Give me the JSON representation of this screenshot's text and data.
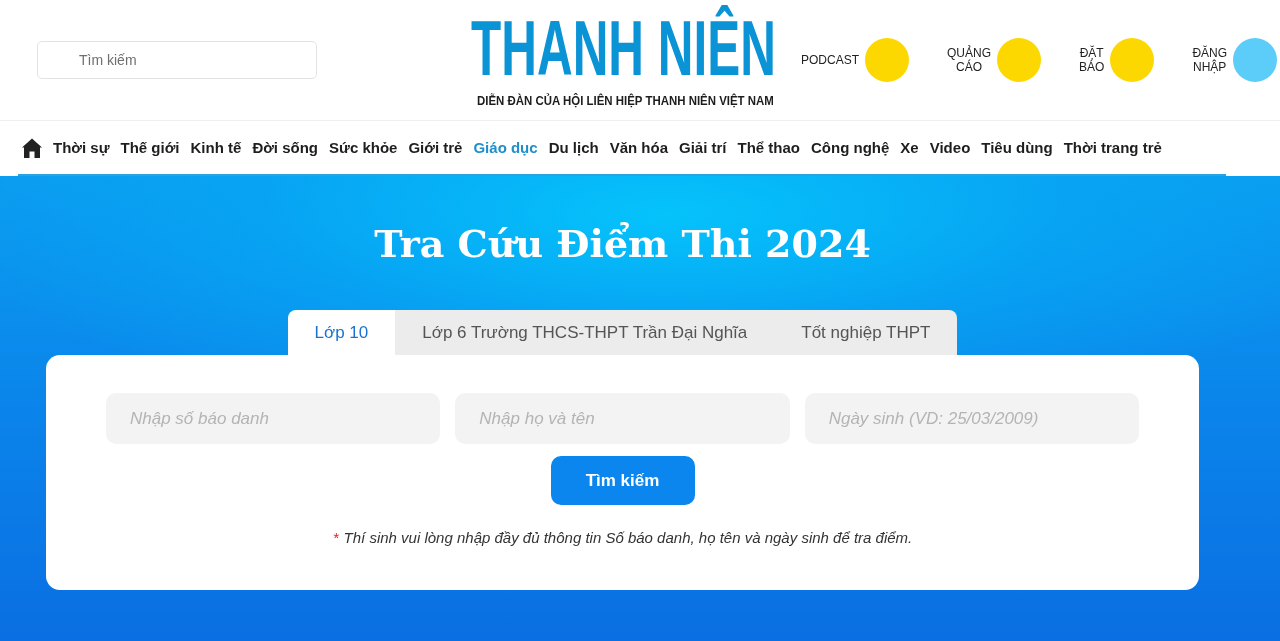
{
  "header": {
    "search": {
      "placeholder": "Tìm kiếm"
    },
    "logo": {
      "title": "THANH NIÊN",
      "tagline": "DIỄN ĐÀN CỦA HỘI LIÊN HIỆP THANH NIÊN VIỆT NAM"
    },
    "links": [
      {
        "label": "PODCAST",
        "color": "#fdd800"
      },
      {
        "label": "QUẢNG CÁO",
        "color": "#fdd800"
      },
      {
        "label": "ĐẶT BÁO",
        "color": "#fdd800"
      },
      {
        "label": "ĐĂNG NHẬP",
        "color": "#5ccdf9"
      }
    ]
  },
  "nav": {
    "items": [
      {
        "label": "Thời sự",
        "selected": false
      },
      {
        "label": "Thế giới",
        "selected": false
      },
      {
        "label": "Kinh tế",
        "selected": false
      },
      {
        "label": "Đời sống",
        "selected": false
      },
      {
        "label": "Sức khỏe",
        "selected": false
      },
      {
        "label": "Giới trẻ",
        "selected": false
      },
      {
        "label": "Giáo dục",
        "selected": true
      },
      {
        "label": "Du lịch",
        "selected": false
      },
      {
        "label": "Văn hóa",
        "selected": false
      },
      {
        "label": "Giải trí",
        "selected": false
      },
      {
        "label": "Thể thao",
        "selected": false
      },
      {
        "label": "Công nghệ",
        "selected": false
      },
      {
        "label": "Xe",
        "selected": false
      },
      {
        "label": "Video",
        "selected": false
      },
      {
        "label": "Tiêu dùng",
        "selected": false
      },
      {
        "label": "Thời trang trẻ",
        "selected": false
      }
    ]
  },
  "lookup": {
    "title": "Tra Cứu Điểm Thi 2024",
    "tabs": [
      {
        "label": "Lớp 10",
        "selected": true
      },
      {
        "label": "Lớp 6 Trường THCS-THPT Trần Đại Nghĩa",
        "selected": false
      },
      {
        "label": "Tốt nghiệp THPT",
        "selected": false
      }
    ],
    "fields": [
      {
        "placeholder": "Nhập số báo danh"
      },
      {
        "placeholder": "Nhập họ và tên"
      },
      {
        "placeholder": "Ngày sinh (VD: 25/03/2009)"
      }
    ],
    "button": "Tìm kiếm",
    "note": {
      "mark": "*",
      "text": "Thí sinh vui lòng nhập đầy đủ thông tin Số báo danh, họ tên và ngày sinh để tra điểm."
    }
  }
}
